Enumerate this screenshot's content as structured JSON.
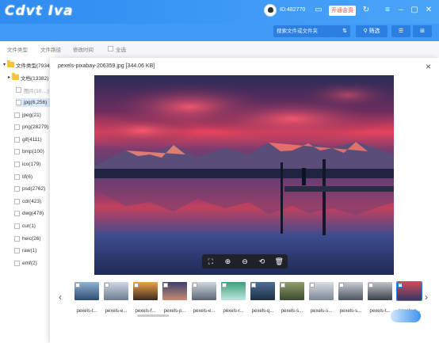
{
  "app": {
    "logo_text": "Cdvt Iva"
  },
  "header": {
    "user_id": "ID:482770",
    "vip_label": "开通会员"
  },
  "toolbar": {
    "search_placeholder": "搜索文件或文件夹",
    "filter_label": "筛选"
  },
  "tabs": [
    "文件类型",
    "文件路径",
    "修改时间"
  ],
  "select_all_label": "全选",
  "tree": {
    "root": "文件类型(79347)",
    "docs": "文档(13382)",
    "hidden_row": "图片(10,...)",
    "items": [
      "jpg(6,256)",
      "jpeg(21)",
      "png(28279)",
      "gif(4111)",
      "bmp(100)",
      "ico(179)",
      "tif(6)",
      "psd(2762)",
      "cdr(423)",
      "dwg(478)",
      "cur(1)",
      "heic(26)",
      "raw(1)",
      "emf(2)"
    ]
  },
  "modal": {
    "title": "pexels-pixabay-206359.jpg [344.06 KB]"
  },
  "thumbnails": [
    {
      "label": "pexels-t...",
      "colors": [
        "#8fb3d9",
        "#2d4b6e"
      ],
      "checked": false
    },
    {
      "label": "pexels-e...",
      "colors": [
        "#cfd8e3",
        "#6d7d90"
      ],
      "checked": false
    },
    {
      "label": "pexels-f...",
      "colors": [
        "#f0a347",
        "#3b2a1f"
      ],
      "checked": false
    },
    {
      "label": "pexels-p...",
      "colors": [
        "#3b3f6f",
        "#c98b6f"
      ],
      "checked": false
    },
    {
      "label": "pexels-e...",
      "colors": [
        "#cfd7de",
        "#5a6772"
      ],
      "checked": false
    },
    {
      "label": "pexels-r...",
      "colors": [
        "#3aa07a",
        "#bfe6e0"
      ],
      "checked": false
    },
    {
      "label": "pexels-q...",
      "colors": [
        "#4d6f95",
        "#1c2f44"
      ],
      "checked": false
    },
    {
      "label": "pexels-s...",
      "colors": [
        "#8e9e6e",
        "#3b4a2d"
      ],
      "checked": false
    },
    {
      "label": "pexels-s...",
      "colors": [
        "#d9dde2",
        "#7c8794"
      ],
      "checked": false
    },
    {
      "label": "pexels-s...",
      "colors": [
        "#c7ccd3",
        "#4c5560"
      ],
      "checked": false
    },
    {
      "label": "pexels-t...",
      "colors": [
        "#bfc5ca",
        "#3a3f45"
      ],
      "checked": false
    },
    {
      "label": "pexels-p...",
      "colors": [
        "#c94b5d",
        "#3b3560"
      ],
      "checked": true
    }
  ],
  "colors": {
    "accent": "#2f8cf0",
    "sky_top": "#2c2a55",
    "sky_glow": "#e8425c"
  }
}
